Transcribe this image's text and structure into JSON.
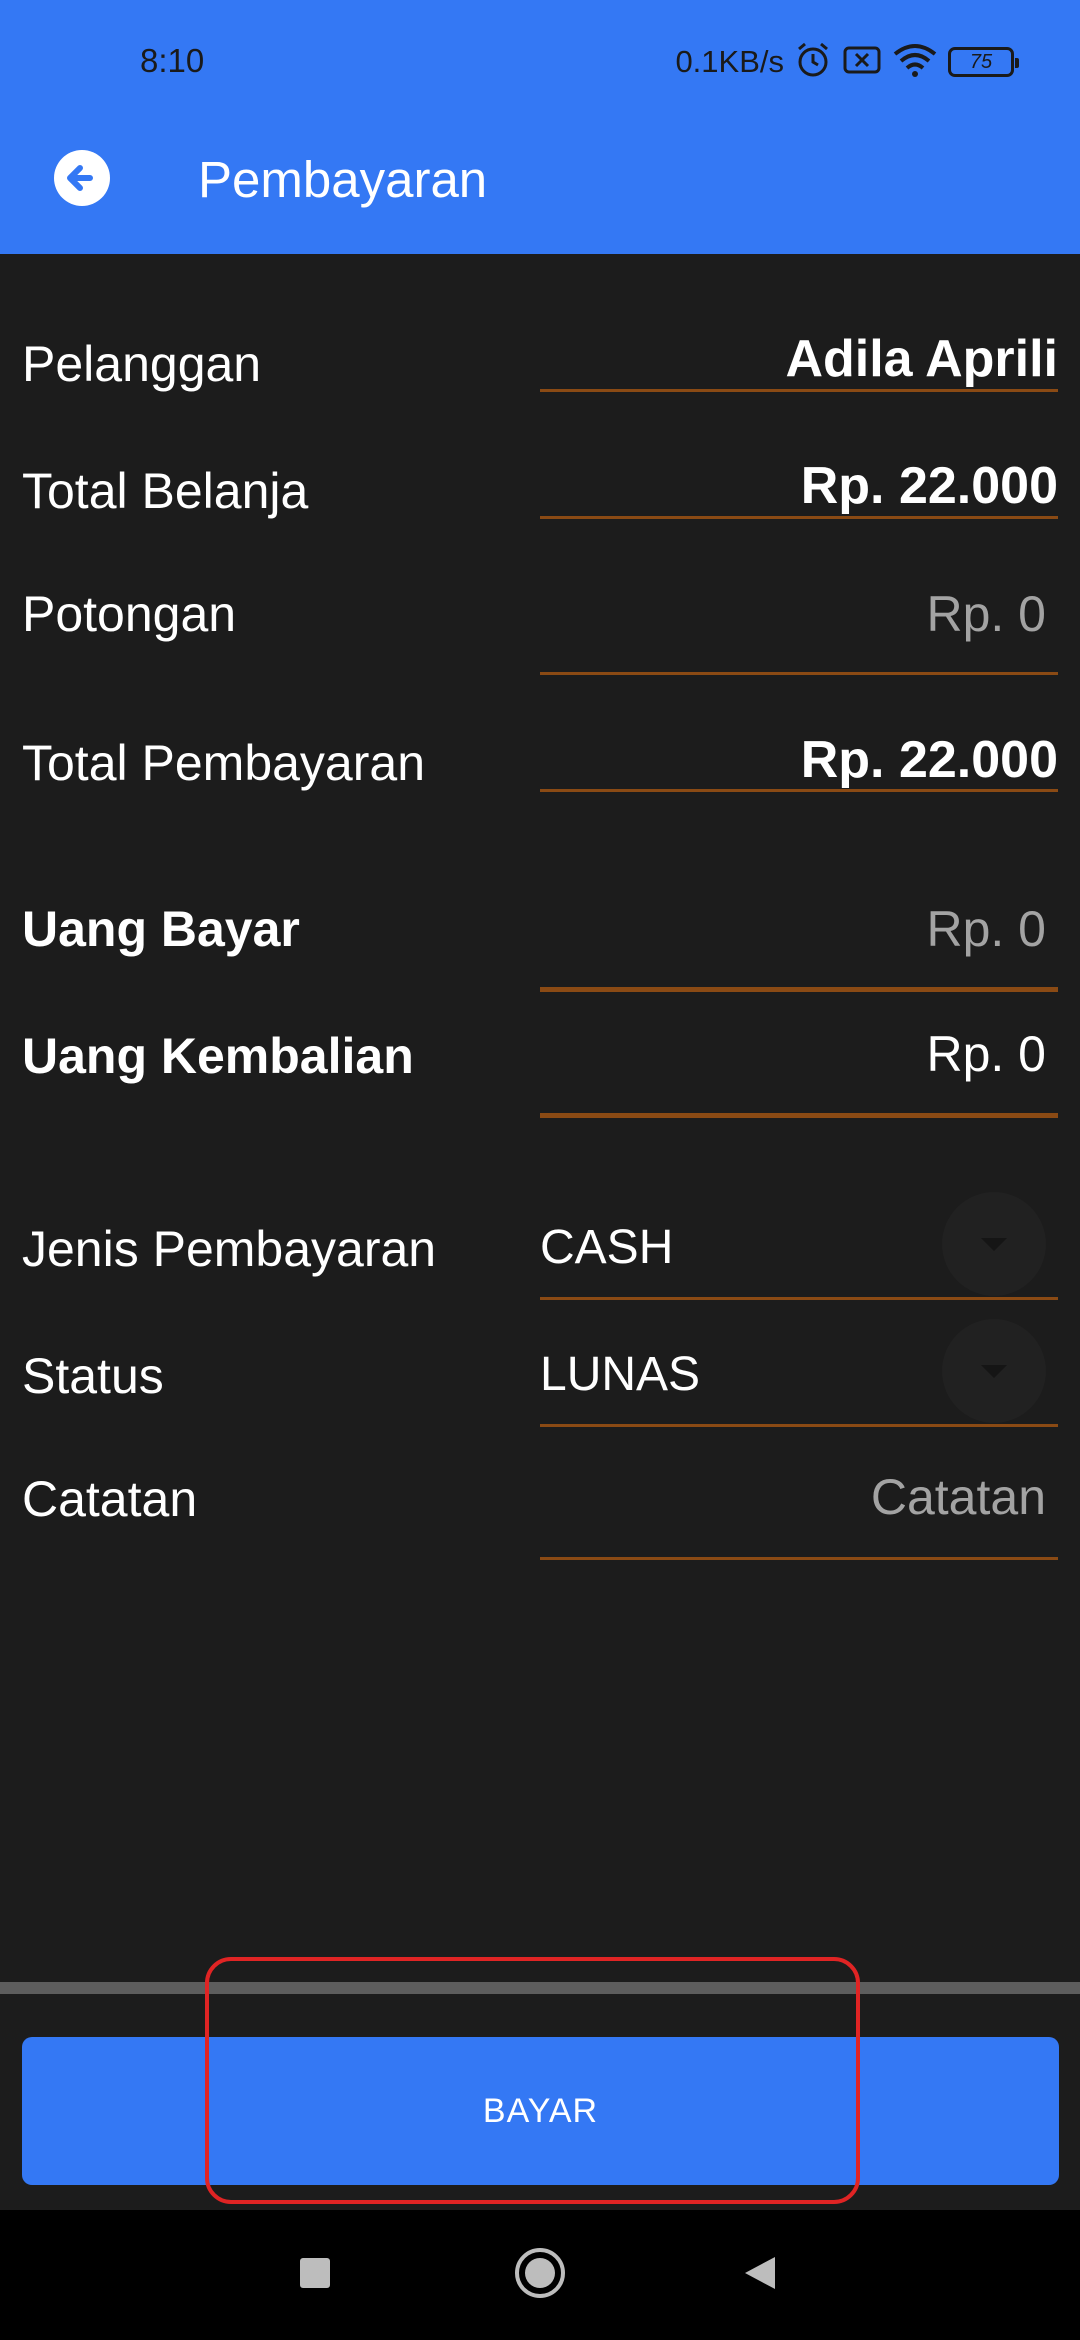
{
  "status_bar": {
    "time": "8:10",
    "network_speed": "0.1KB/s",
    "battery_level": "75",
    "icons": [
      "alarm-icon",
      "sim-disabled-icon",
      "wifi-icon",
      "battery-icon"
    ]
  },
  "app_bar": {
    "title": "Pembayaran",
    "back_icon": "back-arrow-circle-icon"
  },
  "form": {
    "customer": {
      "label": "Pelanggan",
      "value": "Adila Aprili"
    },
    "total_shopping": {
      "label": "Total Belanja",
      "value": "Rp. 22.000"
    },
    "discount": {
      "label": "Potongan",
      "placeholder": "Rp. 0"
    },
    "total_payment": {
      "label": "Total Pembayaran",
      "value": "Rp. 22.000"
    },
    "amount_paid": {
      "label": "Uang Bayar",
      "placeholder": "Rp. 0"
    },
    "change": {
      "label": "Uang Kembalian",
      "value": "Rp. 0"
    },
    "payment_type": {
      "label": "Jenis Pembayaran",
      "selected": "CASH"
    },
    "status": {
      "label": "Status",
      "selected": "LUNAS"
    },
    "note": {
      "label": "Catatan",
      "placeholder": "Catatan"
    }
  },
  "pay_button": {
    "label": "BAYAR"
  },
  "colors": {
    "primary": "#3478f4",
    "background": "#1c1c1c",
    "underline": "#8a4a14",
    "highlight": "#e02424"
  }
}
